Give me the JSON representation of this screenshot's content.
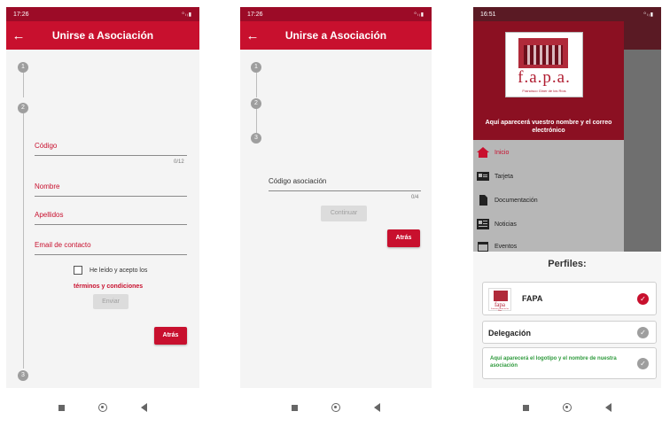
{
  "screen1": {
    "status_time": "17:26",
    "status_icons": "⁰ₗᵢ▮",
    "title": "Unirse a Asociación",
    "back_icon": "←",
    "steps": [
      "1",
      "2",
      "3"
    ],
    "fields": {
      "code": "Código",
      "name": "Nombre",
      "surname": "Apellidos",
      "email": "Email de contacto"
    },
    "code_counter": "0/12",
    "accept_text": "He leído y acepto los",
    "terms_link": "términos y condiciones",
    "send_button": "Enviar",
    "back_button": "Atrás"
  },
  "screen2": {
    "status_time": "17:26",
    "status_icons": "⁰ₗᵢ▮",
    "title": "Unirse a Asociación",
    "back_icon": "←",
    "steps": [
      "1",
      "2",
      "3"
    ],
    "field_label": "Código asociación",
    "counter": "0/4",
    "continue_button": "Continuar",
    "back_button": "Atrás"
  },
  "screen3": {
    "status_time": "16:51",
    "status_icons": "⁰ₗᵢ▮",
    "logo_text": "f.a.p.a.",
    "logo_subtitle": "Francisco Giner de los Ríos",
    "logo_arrow": "↓",
    "header_text": "Aquí aparecerá vuestro nombre y el correo electrónico",
    "menu": [
      {
        "label": "Inicio",
        "icon": "home-icon"
      },
      {
        "label": "Tarjeta",
        "icon": "card-icon"
      },
      {
        "label": "Documentación",
        "icon": "document-icon"
      },
      {
        "label": "Noticias",
        "icon": "news-icon"
      },
      {
        "label": "Eventos",
        "icon": "calendar-icon"
      }
    ],
    "sheet_title": "Perfiles:",
    "profiles": [
      {
        "label": "FAPA",
        "logo_text": "fapa",
        "logo_sub": "Francisco Giner de los Ríos",
        "selected": true
      },
      {
        "label": "Delegación",
        "selected": false
      },
      {
        "label": "Aquí aparecerá el logotipo y el nombre de nuestra asociación",
        "selected": false
      }
    ],
    "check_glyph": "✓"
  },
  "colors": {
    "primary": "#c8102e",
    "status_bar": "#9c0b27",
    "green_note": "#2e9a3c",
    "check_grey": "#9e9e9e"
  }
}
